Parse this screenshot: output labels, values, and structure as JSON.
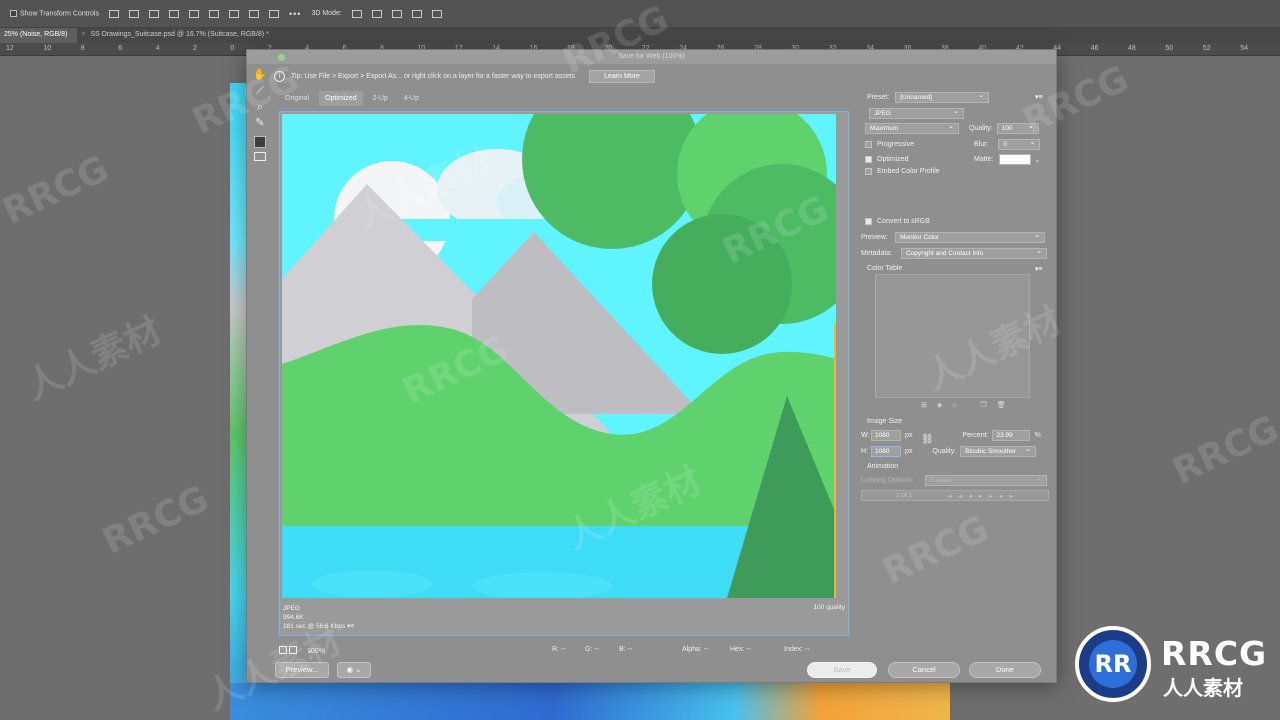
{
  "options_bar": {
    "show_transform_label": "Show Transform Controls",
    "mode_label": "3D Mode:"
  },
  "doc_tabs": [
    {
      "label": "25% (Noise, RGB/8)",
      "active": true
    },
    {
      "label": "SS Drawings_Suitcase.psd @ 16.7% (Suitcase, RGB/8) *",
      "active": false
    }
  ],
  "ruler_ticks": [
    "12",
    "10",
    "8",
    "6",
    "4",
    "2",
    "0",
    "2",
    "4",
    "6",
    "8",
    "10",
    "12",
    "14",
    "16",
    "18",
    "20",
    "22",
    "24",
    "26",
    "28",
    "30",
    "32",
    "34",
    "36",
    "38",
    "40",
    "42",
    "44",
    "46",
    "48",
    "50",
    "52",
    "54"
  ],
  "dialog": {
    "title": "Save for Web (100%)",
    "tip": "Tip: Use File > Export > Export As...  or right click on a layer for a faster way to export assets",
    "learn_more": "Learn More",
    "view_tabs": [
      "Original",
      "Optimized",
      "2-Up",
      "4-Up"
    ],
    "active_view": "Optimized",
    "preview_info": {
      "format": "JPEG",
      "size": "994.6K",
      "time": "181 sec @ 56.6 Kbps",
      "quality": "100 quality"
    },
    "status": {
      "zoom": "100%",
      "r": "R: --",
      "g": "G: --",
      "b": "B: --",
      "alpha": "Alpha: --",
      "hex": "Hex: --",
      "index": "Index: --"
    },
    "buttons": {
      "preview": "Preview...",
      "save": "Save",
      "cancel": "Cancel",
      "done": "Done"
    },
    "settings": {
      "preset_label": "Preset:",
      "preset_value": "[Unnamed]",
      "format": "JPEG",
      "compression": "Maximum",
      "quality_label": "Quality:",
      "quality_value": "100",
      "progressive": "Progressive",
      "blur_label": "Blur:",
      "blur_value": "0",
      "optimized": "Optimized",
      "matte_label": "Matte:",
      "embed_color_profile": "Embed Color Profile",
      "convert_srgb": "Convert to sRGB",
      "preview_label": "Preview:",
      "preview_value": "Monitor Color",
      "metadata_label": "Metadata:",
      "metadata_value": "Copyright and Contact Info",
      "color_table": "Color Table",
      "image_size": "Image Size",
      "w_label": "W:",
      "w_value": "1080",
      "h_label": "H:",
      "h_value": "1080",
      "px": "px",
      "percent_label": "Percent:",
      "percent_value": "23.99",
      "percent_unit": "%",
      "resample_label": "Quality:",
      "resample_value": "Bicubic Smoother",
      "animation": "Animation",
      "looping_label": "Looping Options:",
      "looping_value": "Forever",
      "frame": "1 of 1"
    }
  },
  "watermark": {
    "text_latin": "RRCG",
    "text_cn": "人人素材"
  },
  "colors": {
    "sky": "#5ff4ff",
    "hills": "#5fd26e",
    "water": "#3edcf6",
    "mountain": "#cfcfd2",
    "tree": "#4cbb64",
    "dark_tree": "#3f9b5a"
  }
}
